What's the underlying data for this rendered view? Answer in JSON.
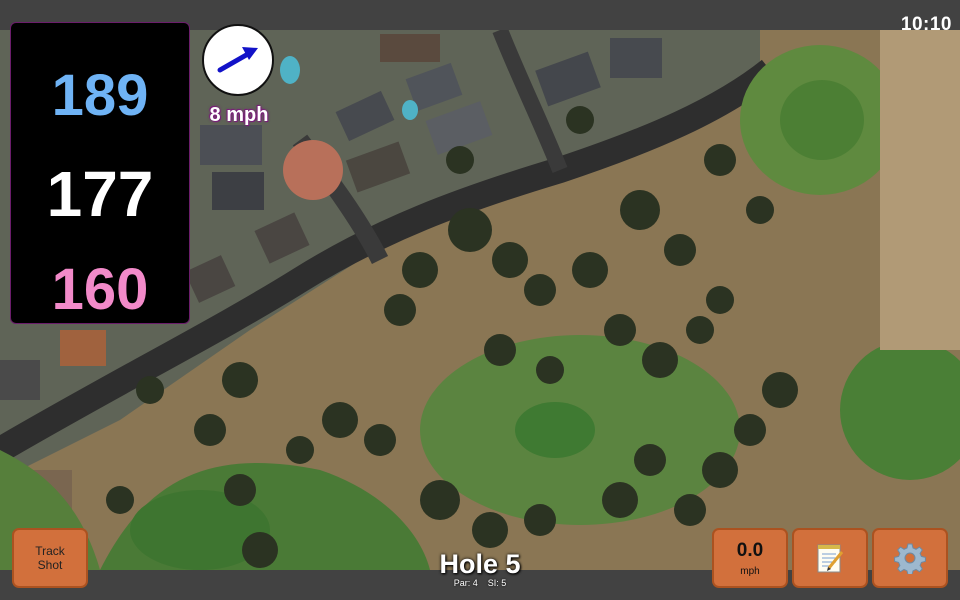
{
  "clock": "10:10",
  "distances": {
    "back": "189",
    "center": "177",
    "front": "160"
  },
  "wind": {
    "speed": "8 mph",
    "icon": "wind-direction-arrow-icon"
  },
  "buttons": {
    "track_shot_line1": "Track",
    "track_shot_line2": "Shot",
    "wind_value": "0.0",
    "wind_unit": "mph",
    "notes_icon": "notepad-icon",
    "settings_icon": "gear-icon"
  },
  "hole": {
    "title": "Hole 5",
    "par": "Par: 4",
    "si": "SI: 5"
  },
  "colors": {
    "back_distance": "#6fb3f5",
    "center_distance": "#ffffff",
    "front_distance": "#f28ac9",
    "button": "#d2703c",
    "bar": "#424242"
  }
}
